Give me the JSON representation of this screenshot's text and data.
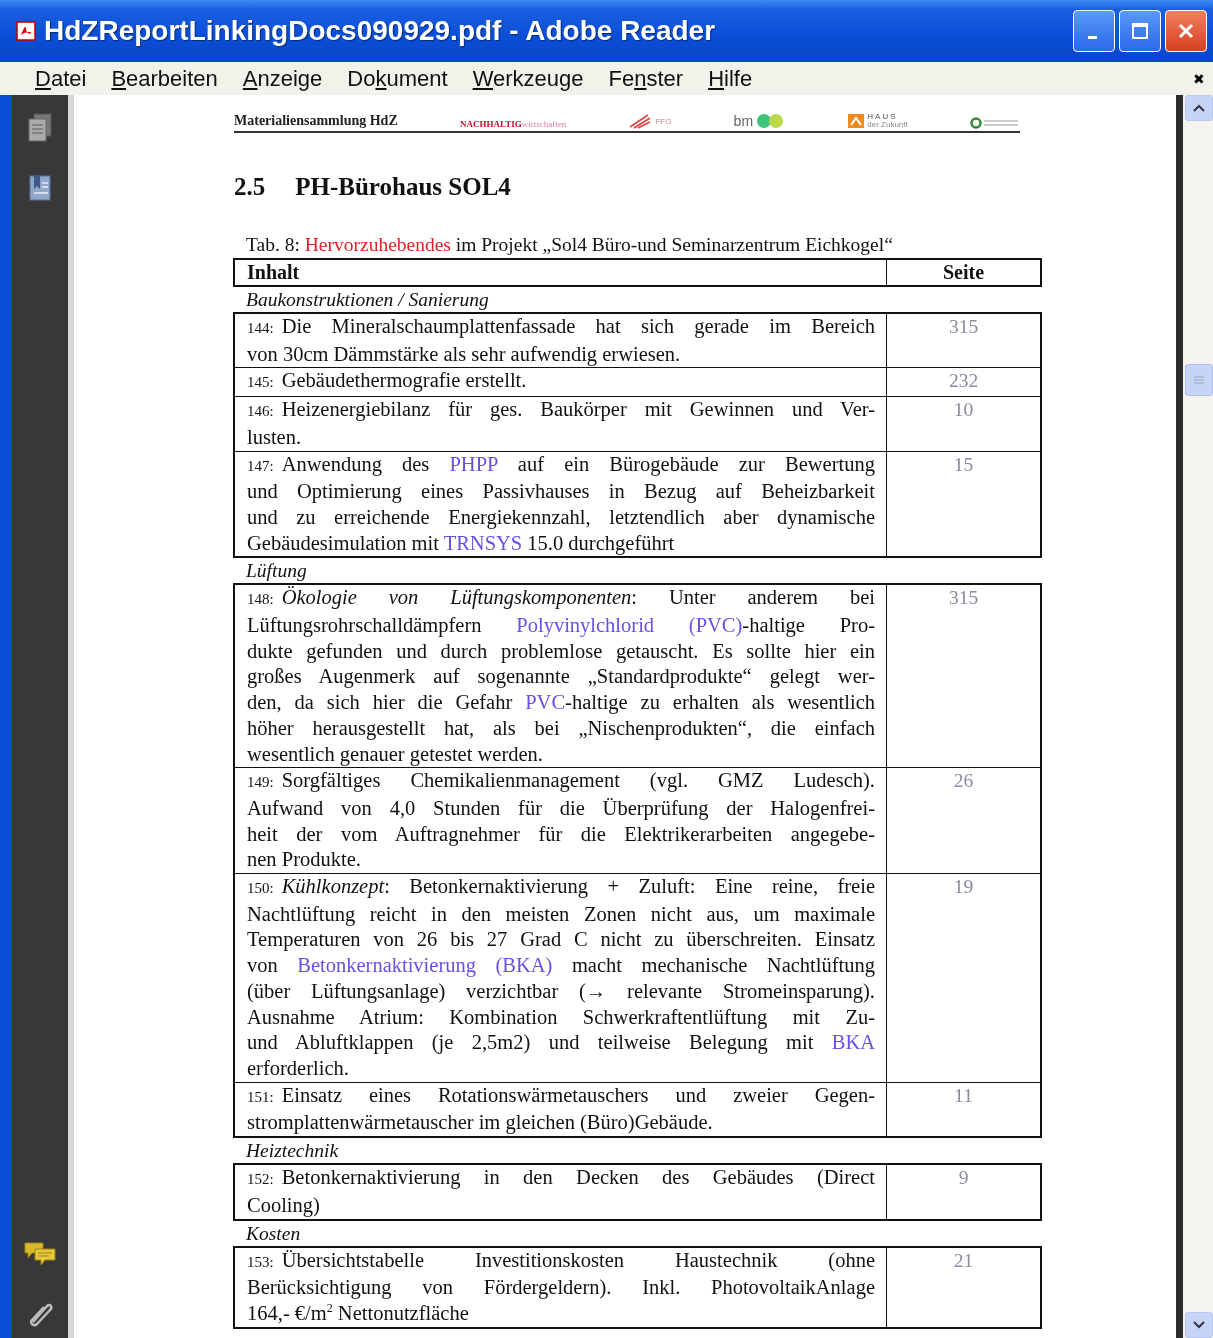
{
  "window": {
    "title": "HdZReportLinkingDocs090929.pdf - Adobe Reader"
  },
  "menu": [
    {
      "key": "D",
      "post": "atei"
    },
    {
      "key": "B",
      "post": "earbeiten"
    },
    {
      "key": "A",
      "post": "nzeige"
    },
    {
      "pre": "Do",
      "key": "k",
      "post": "ument"
    },
    {
      "key": "W",
      "post": "erkzeuge"
    },
    {
      "pre": "Fe",
      "key": "n",
      "post": "ster"
    },
    {
      "key": "H",
      "post": "ilfe"
    }
  ],
  "menu_close": "✖",
  "page_header": {
    "title": "Materialiensammlung HdZ",
    "logos": {
      "nachhaltig_bold": "NACHHALTIG",
      "nachhaltig_light": "wirtschaften",
      "ffg": "FFG",
      "bm": "bm",
      "haus": "HAUS",
      "haus_sub": "der Zukunft"
    }
  },
  "heading": {
    "number": "2.5",
    "title": "PH-Bürohaus SOL4"
  },
  "caption": {
    "prefix": "Tab. 8: ",
    "highlight": "Hervorzuhebendes",
    "rest": " im Projekt „Sol4 Büro-und Seminarzentrum Eichkogel“"
  },
  "table": {
    "columns": [
      "Inhalt",
      "Seite"
    ],
    "sections": [
      {
        "title": "Baukonstruktionen / Sanierung",
        "rows": [
          {
            "number": "144:",
            "page": "315",
            "lines": [
              "Die Mineralschaumplattenfassade hat sich gerade im Bereich",
              "von 30cm Dämmstärke als sehr aufwendig erwiesen."
            ]
          },
          {
            "number": "145:",
            "page": "232",
            "lines": [
              "Gebäudethermografie erstellt."
            ]
          },
          {
            "number": "146:",
            "page": "10",
            "lines": [
              "Heizenergiebilanz für ges. Baukörper mit Gewinnen und Ver-",
              "lusten."
            ]
          },
          {
            "number": "147:",
            "page": "15",
            "lines": [
              [
                {
                  "kind": "text",
                  "text": "Anwendung des "
                },
                {
                  "kind": "link",
                  "text": "PHPP"
                },
                {
                  "kind": "text",
                  "text": " auf ein Bürogebäude zur Bewertung"
                }
              ],
              "und Optimierung eines Passivhauses in Bezug auf Beheizbarkeit",
              "und zu erreichende Energiekennzahl, letztendlich aber dynamische",
              [
                {
                  "kind": "text",
                  "text": "Gebäudesimulation mit "
                },
                {
                  "kind": "link",
                  "text": "TRNSYS"
                },
                {
                  "kind": "text",
                  "text": " 15.0 durchgeführt"
                }
              ]
            ]
          }
        ]
      },
      {
        "title": "Lüftung",
        "rows": [
          {
            "number": "148:",
            "page": "315",
            "lines": [
              "*Ökologie von Lüftungskomponenten*: Unter anderem bei",
              [
                {
                  "kind": "text",
                  "text": "Lüftungsrohrschalldämpfern "
                },
                {
                  "kind": "link",
                  "text": "Polyvinylchlorid (PVC)"
                },
                {
                  "kind": "text",
                  "text": "-haltige Pro-"
                }
              ],
              "dukte gefunden und durch problemlose getauscht. Es sollte hier ein",
              "großes Augenmerk auf sogenannte „Standardprodukte“ gelegt wer-",
              [
                {
                  "kind": "text",
                  "text": "den, da sich hier die Gefahr "
                },
                {
                  "kind": "link",
                  "text": "PVC"
                },
                {
                  "kind": "text",
                  "text": "-haltige zu erhalten als wesentlich"
                }
              ],
              "höher herausgestellt hat, als bei „Nischenprodukten“, die einfach",
              "wesentlich genauer getestet werden."
            ]
          },
          {
            "number": "149:",
            "page": "26",
            "lines": [
              "Sorgfältiges Chemikalienmanagement (vgl. GMZ Ludesch).",
              "Aufwand von 4,0 Stunden für die Überprüfung der Halogenfrei-",
              "heit der vom Auftragnehmer für die Elektrikerarbeiten angegebe-",
              "nen Produkte."
            ]
          },
          {
            "number": "150:",
            "page": "19",
            "lines": [
              "*Kühlkonzept*: Betonkernaktivierung + Zuluft: Eine reine, freie",
              "Nachtlüftung reicht in den meisten Zonen nicht aus, um maximale",
              "Temperaturen von 26 bis 27 Grad C nicht zu überschreiten. Einsatz",
              [
                {
                  "kind": "text",
                  "text": "von "
                },
                {
                  "kind": "link",
                  "text": "Betonkernaktivierung (BKA)"
                },
                {
                  "kind": "text",
                  "text": " macht mechanische Nachtlüftung"
                }
              ],
              "(über Lüftungsanlage) verzichtbar (→ relevante Stromeinsparung).",
              "Ausnahme Atrium: Kombination Schwerkraftentlüftung mit Zu-",
              [
                {
                  "kind": "text",
                  "text": "und Abluftklappen (je 2,5m2) und teilweise Belegung mit "
                },
                {
                  "kind": "link",
                  "text": "BKA"
                }
              ],
              "erforderlich."
            ]
          },
          {
            "number": "151:",
            "page": "11",
            "lines": [
              "Einsatz eines Rotationswärmetauschers und zweier Gegen-",
              "stromplattenwärmetauscher im gleichen (Büro)Gebäude."
            ]
          }
        ]
      },
      {
        "title": "Heiztechnik",
        "rows": [
          {
            "number": "152:",
            "page": "9",
            "lines": [
              "Betonkernaktivierung in den Decken des Gebäudes (Direct",
              "Cooling)"
            ]
          }
        ]
      },
      {
        "title": "Kosten",
        "rows": [
          {
            "number": "153:",
            "page": "21",
            "lines": [
              "Übersichtstabelle Investitionskosten Haustechnik (ohne",
              "Berücksichtigung von Fördergeldern). Inkl. PhotovoltaikAnlage",
              "164,- €/m$^{2}$ Nettonutzfläche"
            ]
          }
        ]
      }
    ]
  }
}
